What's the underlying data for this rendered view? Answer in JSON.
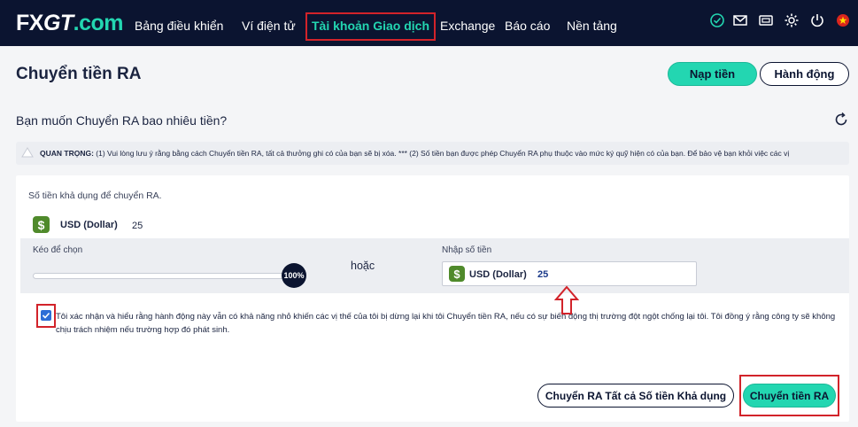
{
  "header": {
    "logo": {
      "fx": "FX",
      "gt": "GT",
      "dotcom": ".com"
    },
    "nav": [
      {
        "label": "Bảng điều khiển"
      },
      {
        "label": "Ví điện tử"
      },
      {
        "label": "Tài khoản Giao dịch"
      },
      {
        "label": "Exchange"
      },
      {
        "label": "Báo cáo"
      },
      {
        "label": "Nền tảng"
      }
    ],
    "icons": [
      "check-circle-icon",
      "mail-icon",
      "wallet-icon",
      "gear-icon",
      "power-icon",
      "vietnam-flag-icon"
    ],
    "accent_color": "#23d6b1",
    "bg_color": "#0b1430"
  },
  "page": {
    "title": "Chuyển tiền RA",
    "deposit_label": "Nạp tiền",
    "action_label": "Hành động",
    "question": "Bạn muốn Chuyển RA bao nhiêu tiền?"
  },
  "notice": {
    "prefix": "QUAN TRỌNG:",
    "text": " (1) Vui lòng lưu ý rằng bằng cách Chuyển tiền RA, tất cả thưởng ghi có của bạn sẽ bị xóa. *** (2) Số tiền bạn được phép Chuyển RA phụ thuộc vào mức ký quỹ hiện có của bạn. Để bảo vệ bạn khỏi việc các vị"
  },
  "withdraw": {
    "available_label": "Số tiền khả dụng để chuyển RA.",
    "currency_symbol": "$",
    "currency_label": "USD (Dollar)",
    "available_amount": "25",
    "slider_label": "Kéo để chọn",
    "slider_percent": "100%",
    "slider_value": 1.0,
    "or_label": "hoặc",
    "enter_label": "Nhập số tiền",
    "input_currency": "USD (Dollar)",
    "input_value": "25",
    "consent_checked": true,
    "consent_text": "Tôi xác nhận và hiểu rằng hành động này vẫn có khả năng nhỏ khiến các vị thế của tôi bị dừng lại khi tôi Chuyển tiền RA, nếu có sự biến động thị trường đột ngột chống lại tôi. Tôi đồng ý rằng công ty sẽ không chịu trách nhiệm nếu trường hợp đó phát sinh.",
    "withdraw_all_label": "Chuyển RA Tất cả Số tiền Khả dụng",
    "withdraw_label": "Chuyển tiền RA"
  },
  "annotation_color": "#d2232a"
}
